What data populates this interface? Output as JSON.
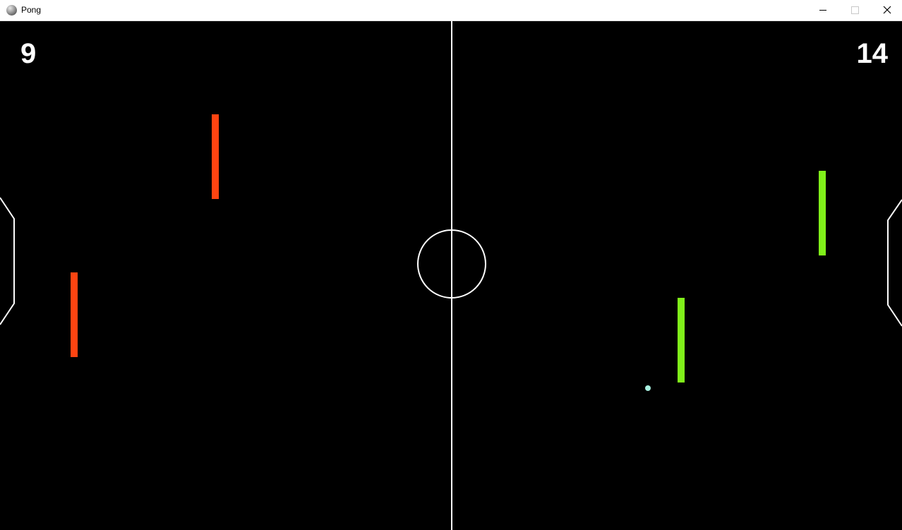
{
  "window": {
    "title": "Pong",
    "icon": "pong-ball-icon"
  },
  "controls": {
    "minimize_icon": "minimize-icon",
    "maximize_icon": "maximize-icon",
    "close_icon": "close-icon"
  },
  "scores": {
    "left": "9",
    "right": "14"
  },
  "colors": {
    "background": "#000000",
    "lines": "#ffffff",
    "left_team": "#ff4411",
    "right_team": "#80f01a",
    "ball": "#a8f0e0"
  }
}
